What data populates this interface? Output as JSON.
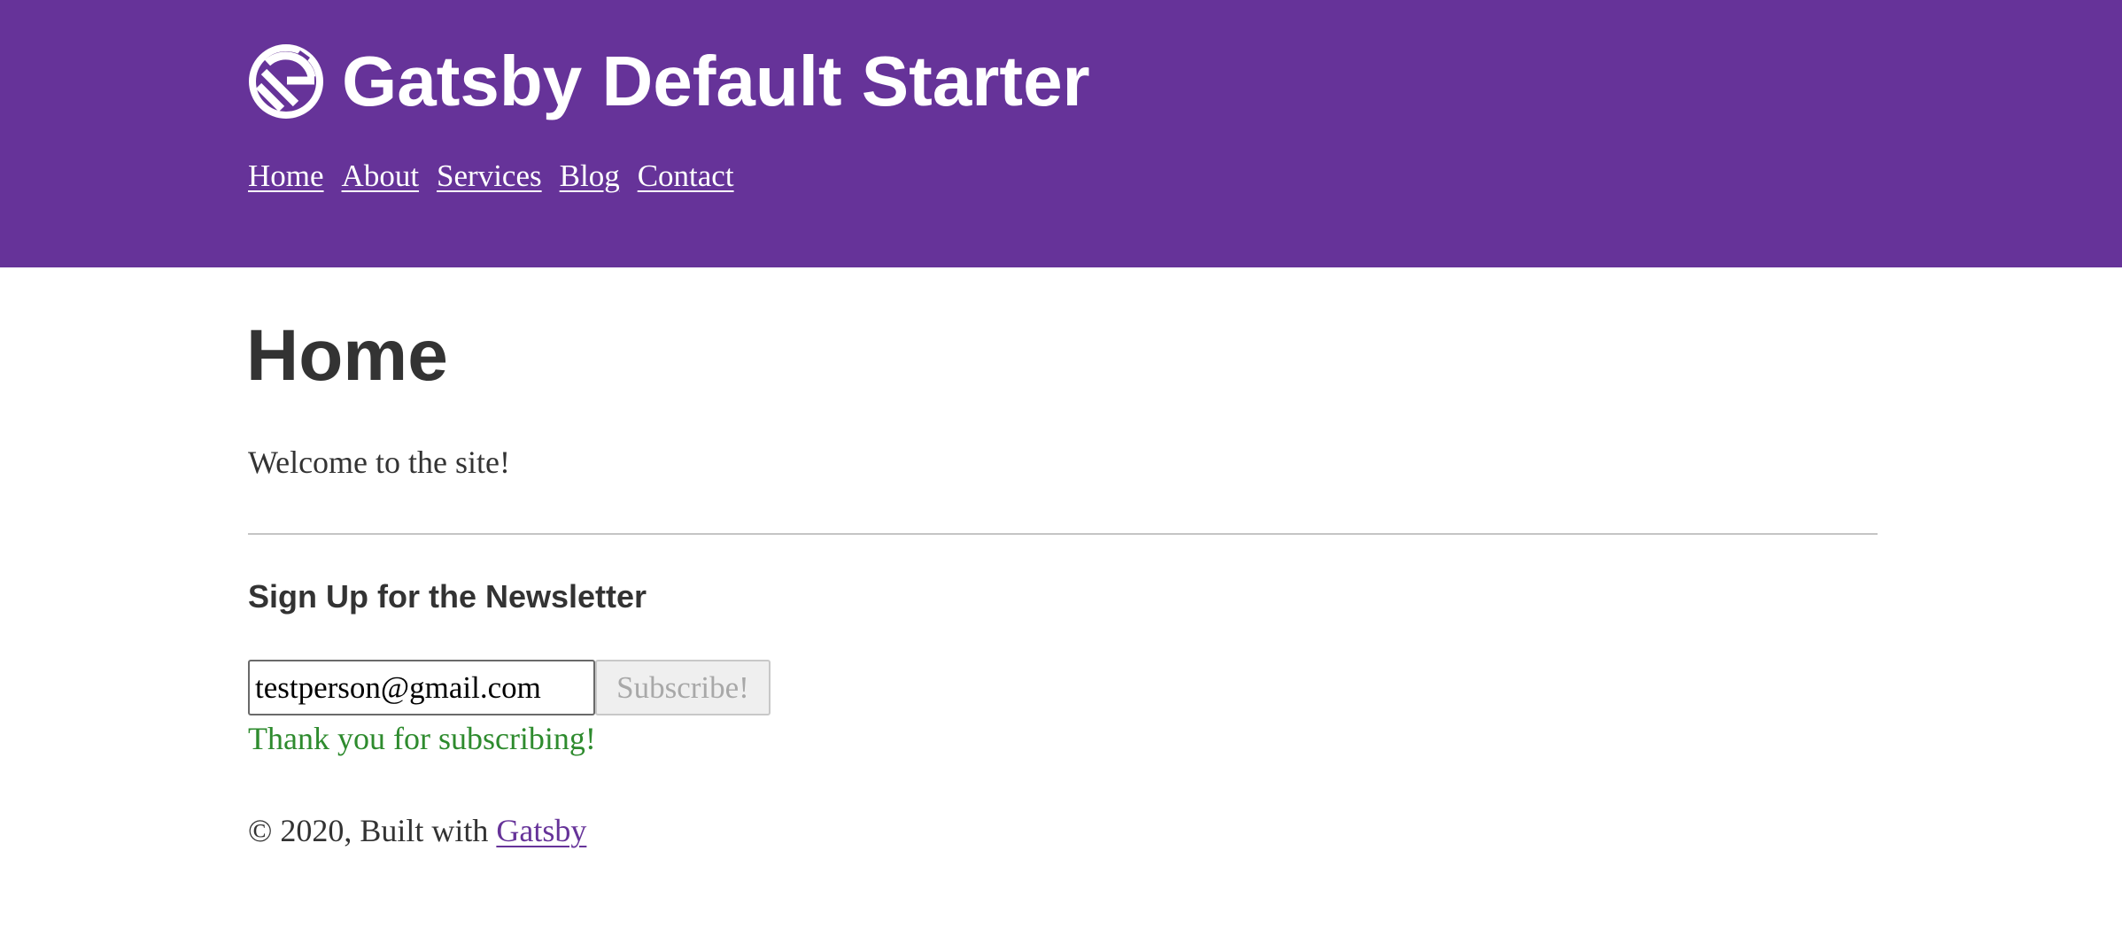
{
  "header": {
    "site_title": "Gatsby Default Starter",
    "logo_icon": "gatsby-logo-icon",
    "nav": [
      {
        "label": "Home"
      },
      {
        "label": "About"
      },
      {
        "label": "Services"
      },
      {
        "label": "Blog"
      },
      {
        "label": "Contact"
      }
    ]
  },
  "main": {
    "title": "Home",
    "welcome": "Welcome to the site!",
    "newsletter": {
      "heading": "Sign Up for the Newsletter",
      "email_value": "testperson@gmail.com",
      "button_label": "Subscribe!",
      "success_message": "Thank you for subscribing!"
    }
  },
  "footer": {
    "text": "© 2020, Built with",
    "link_label": "Gatsby"
  },
  "colors": {
    "brand": "#663399",
    "success": "#2e8b2e",
    "text": "#333333"
  }
}
